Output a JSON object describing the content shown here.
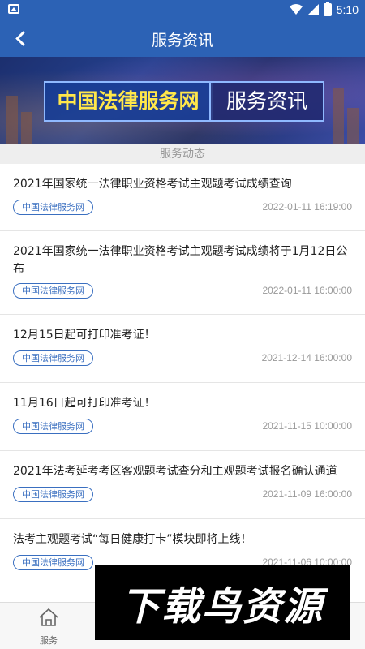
{
  "status_bar": {
    "time": "5:10"
  },
  "app_bar": {
    "title": "服务资讯"
  },
  "banner": {
    "brand": "中国法律服务网",
    "section": "服务资讯"
  },
  "section_header": "服务动态",
  "news": [
    {
      "title": "2021年国家统一法律职业资格考试主观题考试成绩查询",
      "tag": "中国法律服务网",
      "time": "2022-01-11 16:19:00"
    },
    {
      "title": "2021年国家统一法律职业资格考试主观题考试成绩将于1月12日公布",
      "tag": "中国法律服务网",
      "time": "2022-01-11 16:00:00"
    },
    {
      "title": "12月15日起可打印准考证！",
      "tag": "中国法律服务网",
      "time": "2021-12-14 16:00:00"
    },
    {
      "title": "11月16日起可打印准考证！",
      "tag": "中国法律服务网",
      "time": "2021-11-15 10:00:00"
    },
    {
      "title": "2021年法考延考考区客观题考试查分和主观题考试报名确认通道",
      "tag": "中国法律服务网",
      "time": "2021-11-09 16:00:00"
    },
    {
      "title": "法考主观题考试“每日健康打卡”模块即将上线！",
      "tag": "中国法律服务网",
      "time": "2021-11-06 10:00:00"
    }
  ],
  "bottom_nav": {
    "service_label": "服务"
  },
  "watermark": "下载鸟资源",
  "colors": {
    "primary": "#2c62b5",
    "tag": "#3a6fc0",
    "banner_text": "#ffe74a"
  }
}
